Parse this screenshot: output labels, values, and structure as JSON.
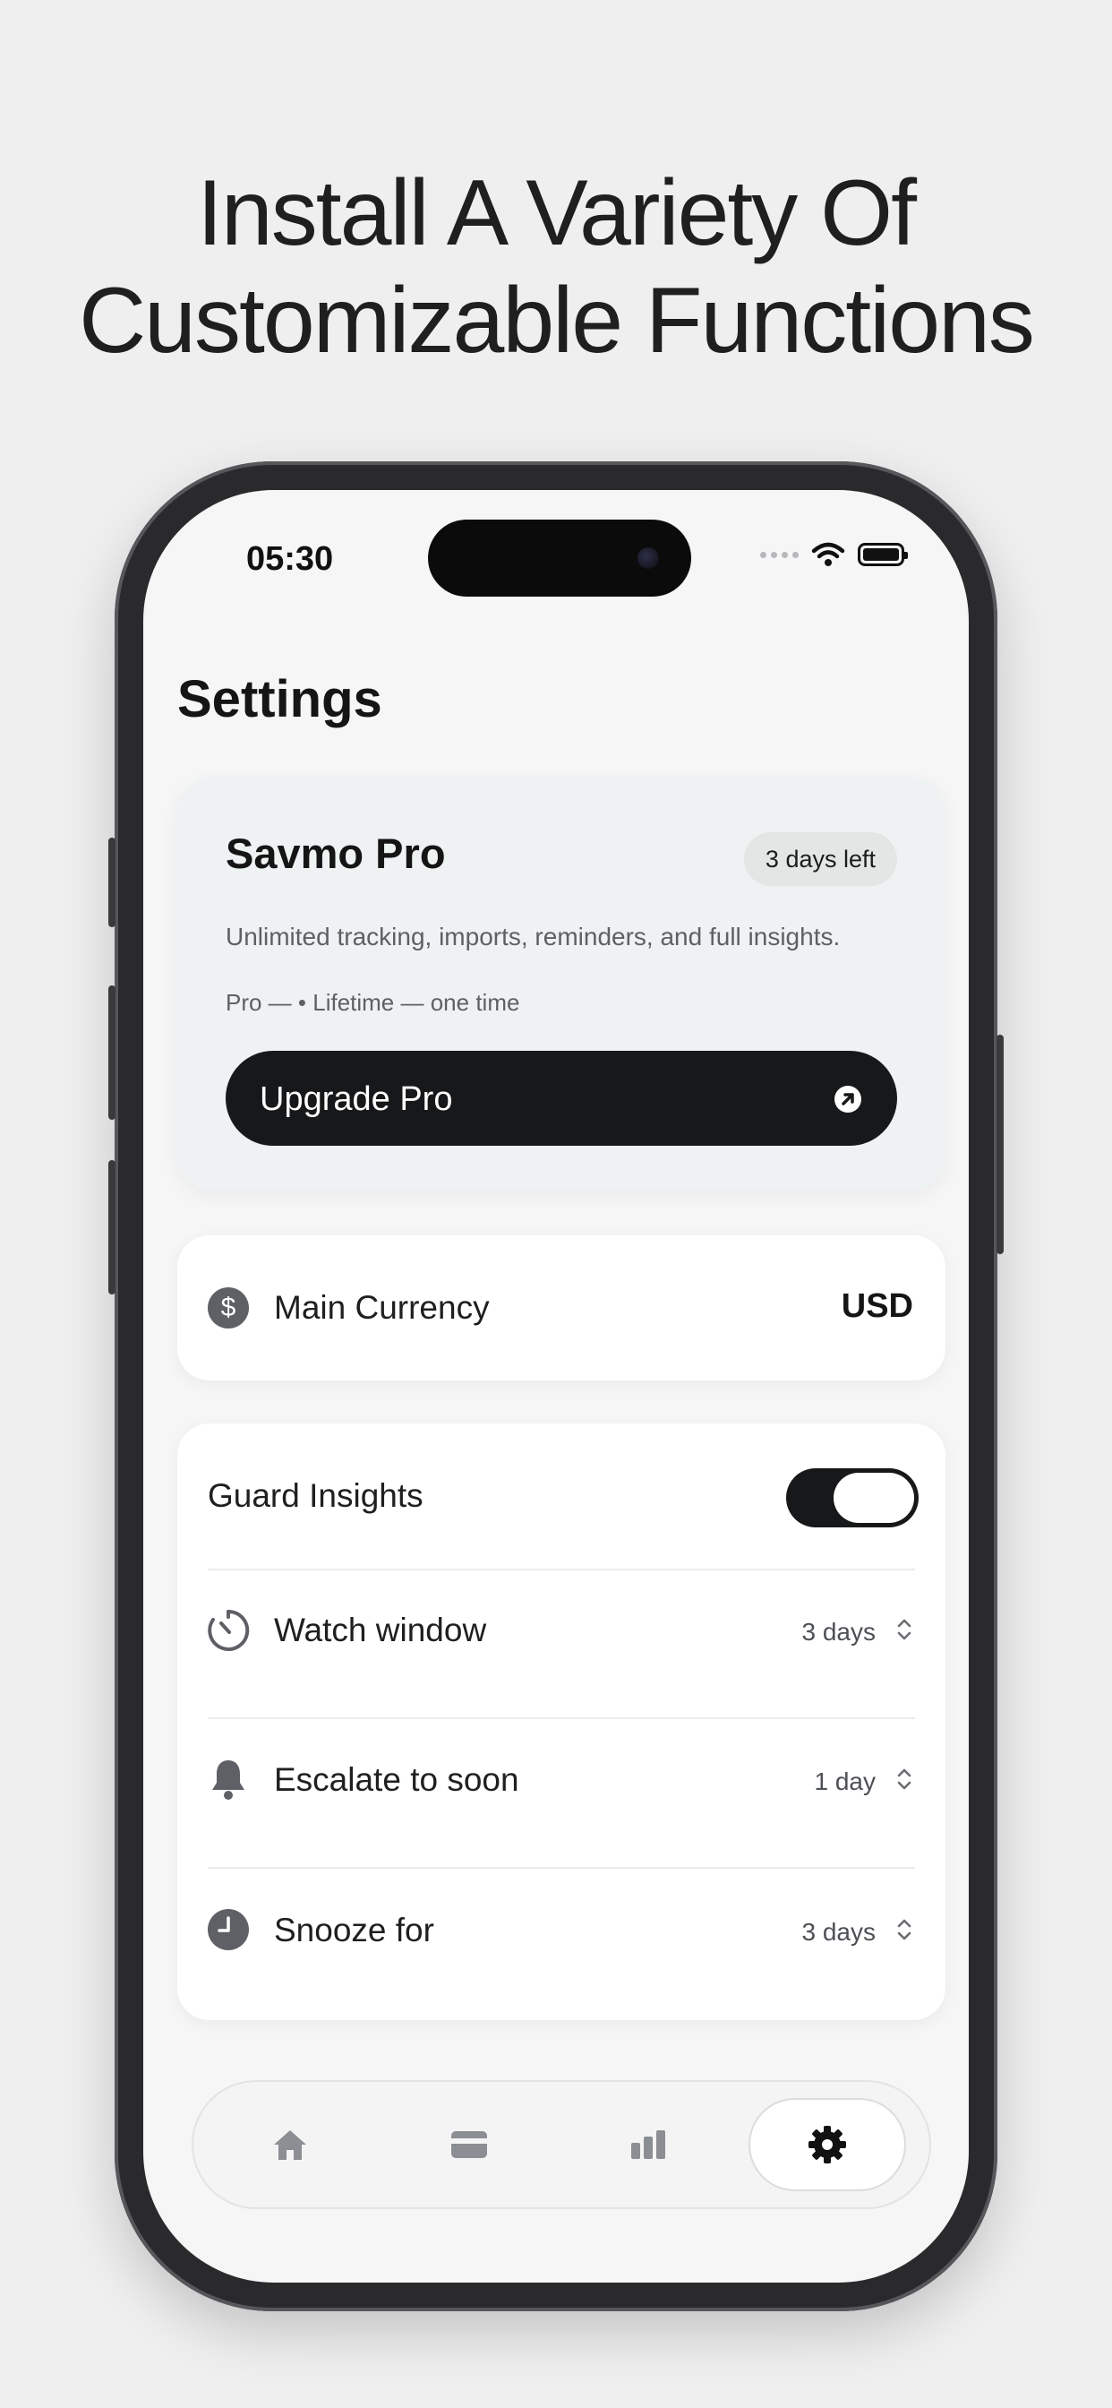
{
  "headline": {
    "line1": "Install A Variety Of",
    "line2": "Customizable Functions"
  },
  "status_bar": {
    "time": "05:30"
  },
  "page": {
    "title": "Settings"
  },
  "pro_card": {
    "title": "Savmo Pro",
    "badge": "3 days left",
    "description": "Unlimited tracking, imports, reminders, and full insights.",
    "plan": "Pro — • Lifetime — one time",
    "upgrade_label": "Upgrade Pro"
  },
  "currency": {
    "icon_glyph": "$",
    "label": "Main Currency",
    "value": "USD"
  },
  "guard": {
    "label": "Guard Insights",
    "enabled": true,
    "rows": [
      {
        "label": "Watch window",
        "value": "3 days",
        "icon": "timer-icon"
      },
      {
        "label": "Escalate to soon",
        "value": "1 day",
        "icon": "bell-icon"
      },
      {
        "label": "Snooze for",
        "value": "3 days",
        "icon": "clock-icon"
      }
    ]
  },
  "tabbar": {
    "tabs": [
      {
        "name": "home",
        "icon": "home-icon",
        "active": false
      },
      {
        "name": "cards",
        "icon": "card-icon",
        "active": false
      },
      {
        "name": "stats",
        "icon": "bar-chart-icon",
        "active": false
      },
      {
        "name": "settings",
        "icon": "gear-icon",
        "active": true
      }
    ]
  },
  "colors": {
    "background": "#efefef",
    "screen": "#f6f6f7",
    "dark_button": "#17181a",
    "pro_card": "#eef2f3",
    "icon_gray": "#5e6066"
  }
}
